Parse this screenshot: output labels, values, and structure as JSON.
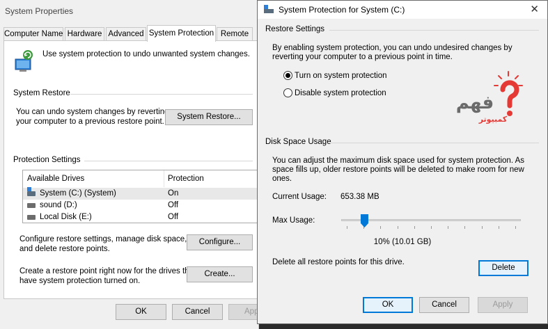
{
  "system_properties": {
    "title": "System Properties",
    "tabs": [
      {
        "label": "Computer Name"
      },
      {
        "label": "Hardware"
      },
      {
        "label": "Advanced"
      },
      {
        "label": "System Protection"
      },
      {
        "label": "Remote"
      }
    ],
    "intro_text": "Use system protection to undo unwanted system changes.",
    "system_restore": {
      "group_label": "System Restore",
      "description_line1": "You can undo system changes by reverting",
      "description_line2": "your computer to a previous restore point.",
      "button_label": "System Restore..."
    },
    "protection_settings": {
      "group_label": "Protection Settings",
      "columns": [
        "Available Drives",
        "Protection"
      ],
      "drives": [
        {
          "name": "System (C:) (System)",
          "protection": "On",
          "icon": "system-drive-icon",
          "selected": true
        },
        {
          "name": "sound (D:)",
          "protection": "Off",
          "icon": "drive-icon",
          "selected": false
        },
        {
          "name": "Local Disk (E:)",
          "protection": "Off",
          "icon": "drive-icon",
          "selected": false
        }
      ],
      "configure_text_line1": "Configure restore settings, manage disk space,",
      "configure_text_line2": "and delete restore points.",
      "configure_button": "Configure...",
      "create_text_line1": "Create a restore point right now for the drives that",
      "create_text_line2": "have system protection turned on.",
      "create_button": "Create..."
    },
    "footer": {
      "ok": "OK",
      "cancel": "Cancel",
      "apply": "Apply",
      "apply_visible": "App"
    }
  },
  "protection_dialog": {
    "title": "System Protection for System (C:)",
    "restore_settings": {
      "group_label": "Restore Settings",
      "description_line1": "By enabling system protection, you can undo undesired changes by",
      "description_line2": "reverting your computer to a previous point in time.",
      "options": [
        {
          "label": "Turn on system protection",
          "selected": true
        },
        {
          "label": "Disable system protection",
          "selected": false
        }
      ]
    },
    "disk_space": {
      "group_label": "Disk Space Usage",
      "description_line1": "You can adjust the maximum disk space used for system protection. As",
      "description_line2": "space fills up, older restore points will be deleted to make room for new",
      "description_line3": "ones.",
      "current_usage_label": "Current Usage:",
      "current_usage_value": "653.38 MB",
      "max_usage_label": "Max Usage:",
      "max_usage_fraction": 0.1,
      "max_usage_text": "10% (10.01 GB)",
      "delete_text": "Delete all restore points for this drive.",
      "delete_button": "Delete"
    },
    "buttons": {
      "ok": "OK",
      "cancel": "Cancel",
      "apply": "Apply"
    },
    "logo_text_top": "فهم",
    "logo_text_bottom": "كمبيوتر"
  },
  "colors": {
    "accent": "#0078d7",
    "logo_red": "#e53935",
    "logo_gray": "#6b6b6b"
  }
}
